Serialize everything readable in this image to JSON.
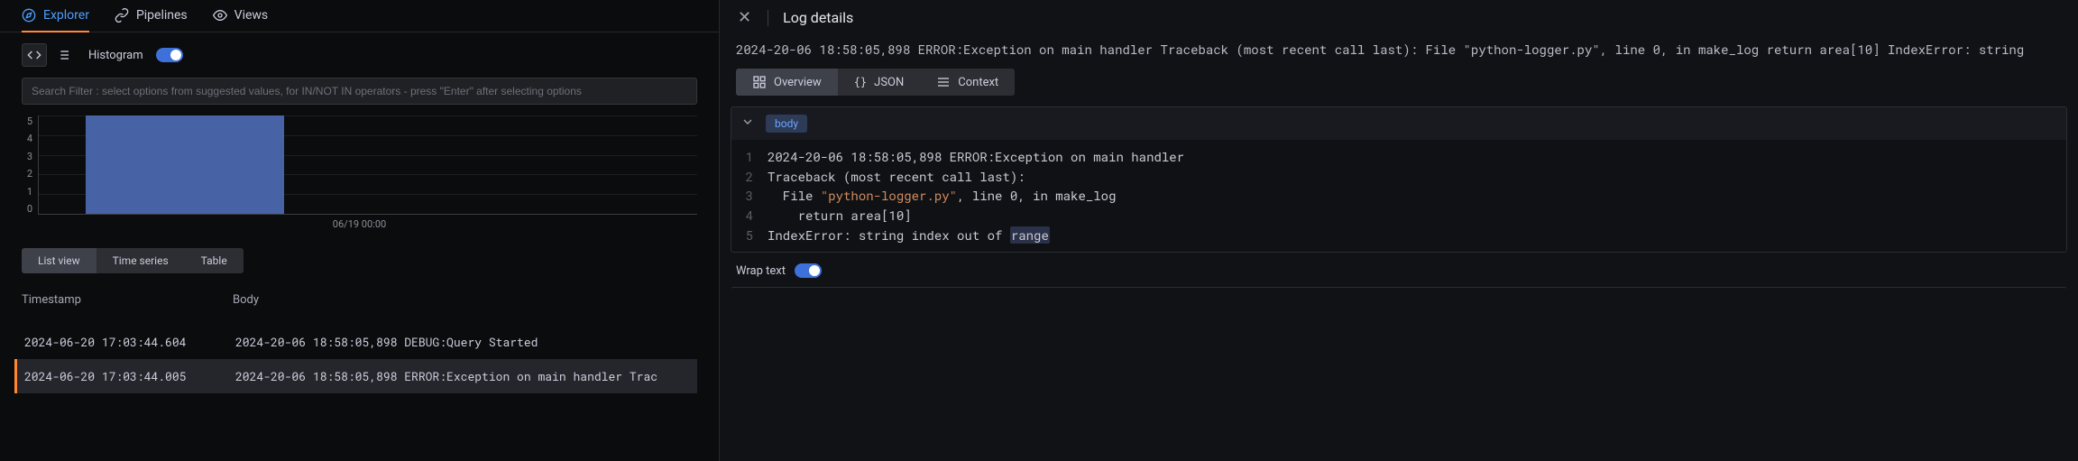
{
  "tabs": {
    "items": [
      {
        "label": "Explorer",
        "icon": "compass-icon"
      },
      {
        "label": "Pipelines",
        "icon": "link-icon"
      },
      {
        "label": "Views",
        "icon": "eye-icon"
      }
    ]
  },
  "toolbar": {
    "histogram_label": "Histogram"
  },
  "filter": {
    "placeholder": "Search Filter : select options from suggested values, for IN/NOT IN operators - press \"Enter\" after selecting options"
  },
  "chart_data": {
    "type": "bar",
    "categories": [
      "06/19 00:00"
    ],
    "values": [
      5
    ],
    "ylabel": "",
    "ylim": [
      0,
      5
    ],
    "yticks": [
      5,
      4,
      3,
      2,
      1,
      0
    ]
  },
  "view_pills": [
    "List view",
    "Time series",
    "Table"
  ],
  "table": {
    "headers": {
      "timestamp": "Timestamp",
      "body": "Body"
    },
    "rows": [
      {
        "ts": "2024-06-20 17:03:44.604",
        "body": "2024-20-06 18:58:05,898 DEBUG:Query Started"
      },
      {
        "ts": "2024-06-20 17:03:44.005",
        "body": "2024-20-06 18:58:05,898 ERROR:Exception on main handler Trac"
      }
    ]
  },
  "drawer": {
    "title": "Log details",
    "summary": "2024-20-06 18:58:05,898 ERROR:Exception on main handler Traceback (most recent call last): File \"python-logger.py\", line 0, in make_log return area[10] IndexError: string",
    "tabs": [
      "Overview",
      "JSON",
      "Context"
    ],
    "body_tag": "body",
    "code": {
      "lines": [
        {
          "n": "1",
          "text": "2024-20-06 18:58:05,898 ERROR:Exception on main handler"
        },
        {
          "n": "2",
          "text": "Traceback (most recent call last):"
        },
        {
          "n": "3",
          "prefix": "  File ",
          "str": "\"python-logger.py\"",
          "suffix": ", line 0, in make_log"
        },
        {
          "n": "4",
          "text": "    return area[10]"
        },
        {
          "n": "5",
          "prefix": "IndexError: string index out of ",
          "sel": "range"
        }
      ]
    },
    "wrap_label": "Wrap text"
  }
}
